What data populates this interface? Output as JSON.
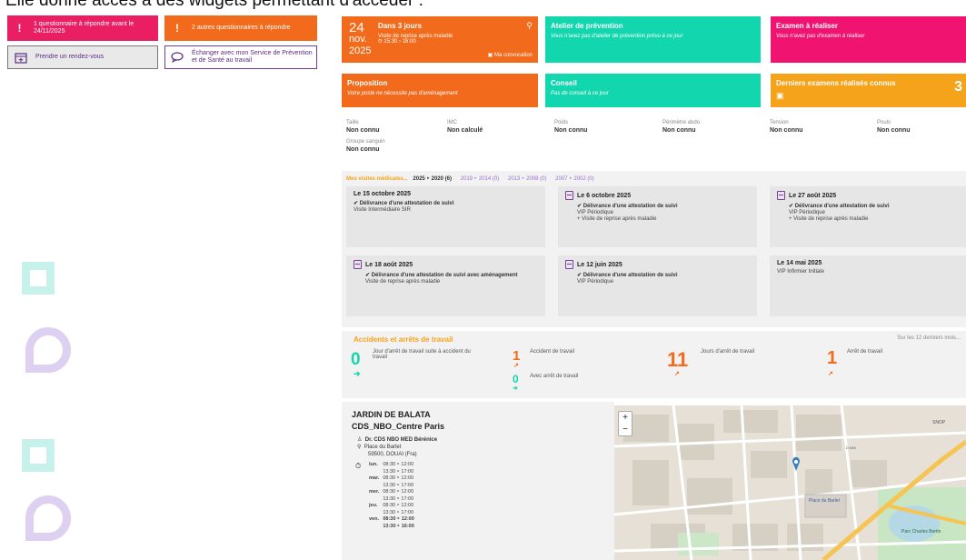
{
  "caption": "Elle donne accès à des widgets permettant d'accéder :",
  "left_widgets": {
    "questionnaire": "1 questionnaire à répondre avant le 24/11/2025",
    "others": "2 autres questionnaires à répondre",
    "appointment": "Prendre un rendez-vous",
    "exchange": "Échanger avec mon Service de Prévention et de Santé au travail"
  },
  "tiles": {
    "convocation": {
      "day": "24",
      "month": "nov.",
      "year": "2025",
      "title": "Dans 3 jours",
      "subtitle": "Visite de reprise après maladie",
      "time": "15:30 › 16:00",
      "link": "Ma convocation"
    },
    "atelier": {
      "title": "Atelier de prévention",
      "text": "Vous n'avez pas d'atelier de prévention prévu à ce jour"
    },
    "examen": {
      "title": "Examen à réaliser",
      "text": "Vous n'avez pas d'examen à réaliser"
    },
    "proposition": {
      "title": "Proposition",
      "text": "Votre poste ne nécessite pas d'aménagement"
    },
    "conseil": {
      "title": "Conseil",
      "text": "Pas de conseil à ce jour"
    },
    "derniers": {
      "title": "Derniers examens réalisés connus",
      "count": "3"
    }
  },
  "measures": [
    {
      "label": "Taille",
      "value": "Non connu"
    },
    {
      "label": "IMC",
      "value": "Non calculé"
    },
    {
      "label": "Poids",
      "value": "Non connu"
    },
    {
      "label": "Périmètre abdo.",
      "value": "Non connu"
    },
    {
      "label": "Tension",
      "value": "Non connu"
    },
    {
      "label": "Pouls",
      "value": "Non connu"
    }
  ],
  "blood": {
    "label": "Groupe sanguin",
    "value": "Non connu"
  },
  "visits": {
    "header": "Mes visites médicales...",
    "years": [
      {
        "text": "2025 ‣ 2020 (6)"
      },
      {
        "text": "2019 ‣ 2014 (0)"
      },
      {
        "text": "2013 ‣ 2008 (0)"
      },
      {
        "text": "2007 ‣ 2002 (0)"
      }
    ],
    "cards": [
      {
        "date": "Le 15 octobre 2025",
        "cert": "✔ Délivrance d'une attestation de suivi",
        "type": "Visite Intermédiaire SIR",
        "extra": ""
      },
      {
        "date": "Le 6 octobre 2025",
        "cert": "✔ Délivrance d'une attestation de suivi",
        "type": "VIP Périodique",
        "extra": "+ Visite de reprise après maladie"
      },
      {
        "date": "Le 27 août 2025",
        "cert": "✔ Délivrance d'une attestation de suivi",
        "type": "VIP Périodique",
        "extra": "+ Visite de reprise après maladie"
      },
      {
        "date": "Le 18 août 2025",
        "cert": "✔ Délivrance d'une attestation de suivi avec aménagement",
        "type": "Visite de reprise après maladie",
        "extra": ""
      },
      {
        "date": "Le 12 juin 2025",
        "cert": "✔ Délivrance d'une attestation de suivi",
        "type": "VIP Périodique",
        "extra": ""
      },
      {
        "date": "Le 14 mai 2025",
        "cert": "",
        "type": "VIP Infirmier Initiale",
        "extra": ""
      }
    ]
  },
  "accidents": {
    "title": "Accidents et arrêts de travail",
    "period": "Sur les 12 derniers mois...",
    "days_after_accident": {
      "value": "0",
      "label": "Jour d'arrêt de travail suite à accident du travail"
    },
    "accident": {
      "value": "1",
      "label": "Accident de travail"
    },
    "with_stop": {
      "value": "0",
      "label": "Avec arrêt de travail"
    },
    "days_stop": {
      "value": "11",
      "label": "Jours d'arrêt de travail"
    },
    "stops": {
      "value": "1",
      "label": "Arrêt de travail"
    }
  },
  "center": {
    "name": "JARDIN DE BALATA",
    "code": "CDS_NBO_Centre Paris",
    "doctor": "Dr. CDS NBO MED Bérénice",
    "address1": "Place du Barlet",
    "address2": "59500, DOUAI (Fra)",
    "hours": [
      {
        "day": "lun.",
        "a": "08:30 ‣ 12:00",
        "b": "13:30 ‣ 17:00"
      },
      {
        "day": "mar.",
        "a": "08:30 ‣ 12:00",
        "b": "13:30 ‣ 17:00"
      },
      {
        "day": "mer.",
        "a": "08:30 ‣ 12:00",
        "b": "13:30 ‣ 17:00"
      },
      {
        "day": "jeu.",
        "a": "08:30 ‣ 12:00",
        "b": "13:30 ‣ 17:00"
      },
      {
        "day": "ven.",
        "a": "08:30 ‣ 12:00",
        "b": "13:30 ‣ 16:00"
      }
    ]
  },
  "map": {
    "zoom_in": "+",
    "zoom_out": "−",
    "labels": [
      "Place du Barlet",
      "Parc Charles Bertin",
      "SNOP",
      "D 645"
    ]
  },
  "colors": {
    "orange": "#f26a1b",
    "teal": "#12d6ad",
    "pink": "#f0136f",
    "amber": "#f5a31a",
    "purple": "#6b3fa0"
  }
}
